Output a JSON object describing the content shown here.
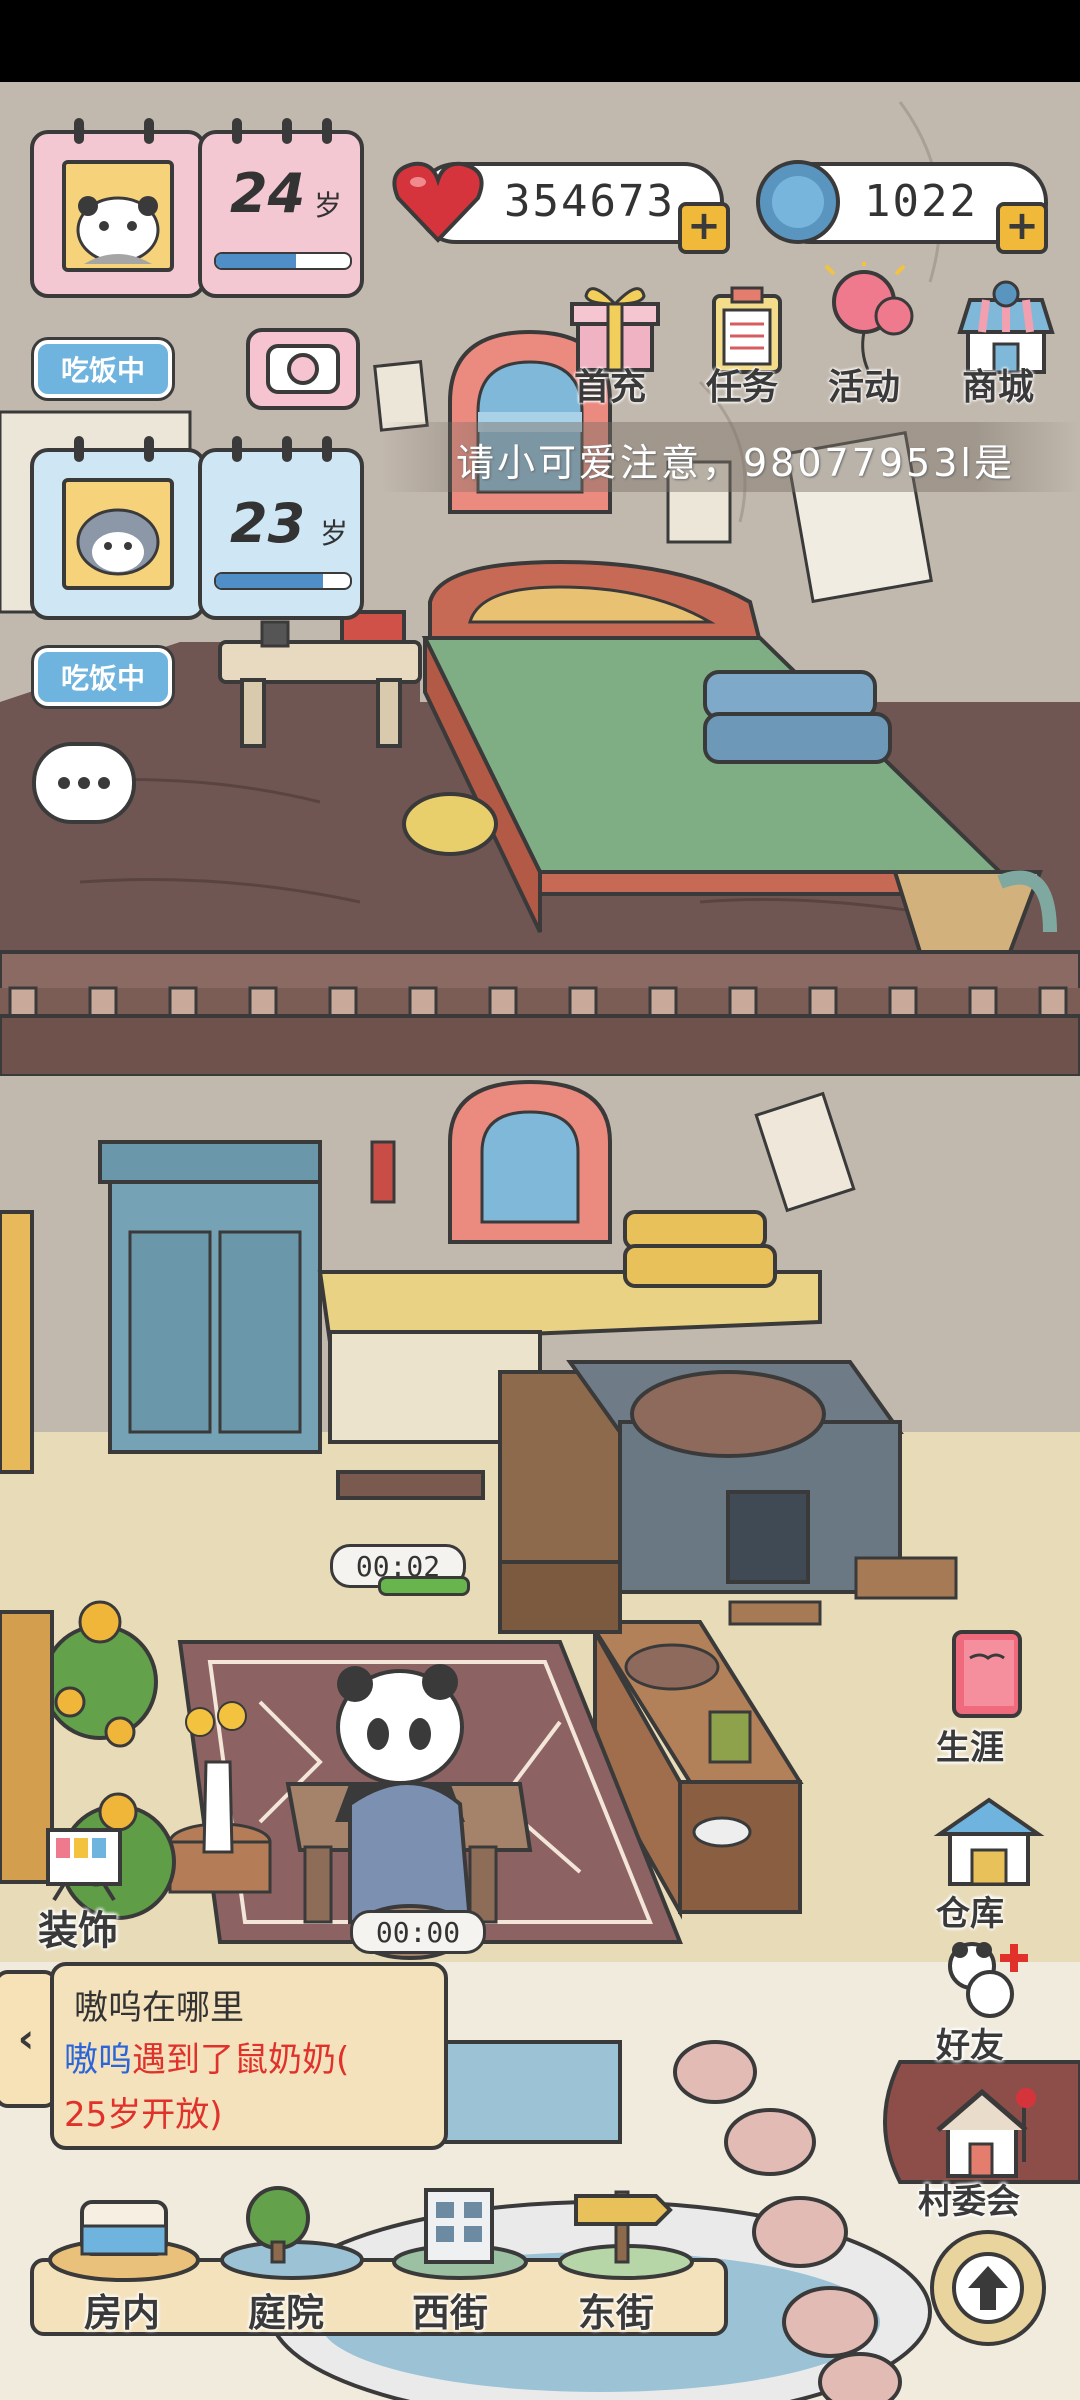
{
  "hud": {
    "pet1": {
      "age_value": "24",
      "age_unit": "岁",
      "status": "吃饭中",
      "progress": 0.6
    },
    "pet2": {
      "age_value": "23",
      "age_unit": "岁",
      "status": "吃饭中",
      "progress": 0.8
    },
    "hearts": "354673",
    "coins": "1022",
    "top_menu": [
      {
        "label": "首充",
        "icon": "gift-icon"
      },
      {
        "label": "任务",
        "icon": "clipboard-icon"
      },
      {
        "label": "活动",
        "icon": "balloon-icon"
      },
      {
        "label": "商城",
        "icon": "shop-icon"
      }
    ],
    "notice": "请小可爱注意，98077953l是"
  },
  "timers": {
    "cook": "00:02",
    "eat": "00:00"
  },
  "side_menu": [
    {
      "label": "生涯",
      "icon": "book-icon"
    },
    {
      "label": "仓库",
      "icon": "warehouse-icon"
    },
    {
      "label": "好友",
      "icon": "friends-icon"
    },
    {
      "label": "村委会",
      "icon": "village-house-icon"
    }
  ],
  "decorate": {
    "label": "装饰"
  },
  "story": {
    "title": "嗷呜在哪里",
    "name": "嗷呜",
    "text": "遇到了鼠奶奶(",
    "line2": "25岁开放)"
  },
  "nav": [
    {
      "label": "房内",
      "icon": "bed-icon"
    },
    {
      "label": "庭院",
      "icon": "tree-icon"
    },
    {
      "label": "西街",
      "icon": "building-icon"
    },
    {
      "label": "东街",
      "icon": "signpost-icon"
    }
  ],
  "colors": {
    "wall": "#c2b9ae",
    "upper_floor": "#6f5652",
    "lower_floor": "#e8dbb8",
    "mat_green": "#7fae85",
    "accent_blue": "#6fb3df",
    "heart_red": "#d6343c",
    "story_red": "#e0312b",
    "story_blue": "#2b65d8"
  }
}
